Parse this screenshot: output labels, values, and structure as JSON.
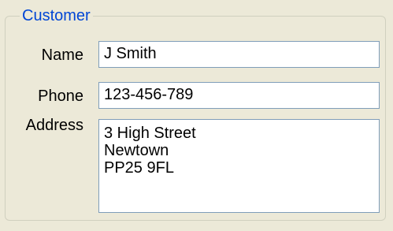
{
  "group": {
    "title": "Customer"
  },
  "fields": {
    "name_label": "Name",
    "name_value": "J Smith",
    "phone_label": "Phone",
    "phone_value": "123-456-789",
    "address_label": "Address",
    "address_lines": [
      "3 High Street",
      "Newtown",
      "PP25 9FL"
    ]
  }
}
